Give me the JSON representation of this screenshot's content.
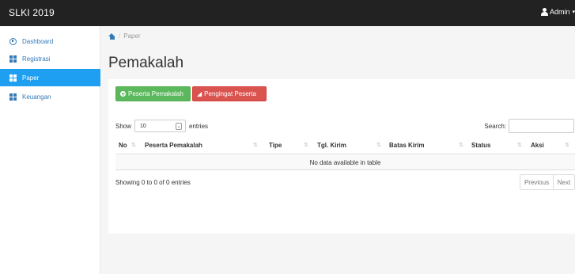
{
  "app": {
    "title": "SLKI 2019",
    "user_label": "Admin"
  },
  "sidebar": {
    "items": [
      {
        "label": "Dashboard",
        "icon": "dashboard-icon",
        "active": false
      },
      {
        "label": "Registrasi",
        "icon": "grid-icon",
        "active": false
      },
      {
        "label": "Paper",
        "icon": "grid-icon",
        "active": true
      },
      {
        "label": "Keuangan",
        "icon": "grid-icon",
        "active": false
      }
    ]
  },
  "breadcrumb": {
    "current": "Paper",
    "separator": "/"
  },
  "page": {
    "title": "Pemakalah"
  },
  "actions": {
    "peserta_pemakalah": "Peserta Pemakalah",
    "pengingat_peserta": "Pengingat Peserta"
  },
  "table": {
    "show_label": "Show",
    "entries_value": "10",
    "entries_label": "entries",
    "search_label": "Search:",
    "columns": [
      "No",
      "Peserta Pemakalah",
      "Tipe",
      "Tgl. Kirim",
      "Batas Kirim",
      "Status",
      "Aksi"
    ],
    "empty_message": "No data available in table",
    "info": "Showing 0 to 0 of 0 entries",
    "pagination": {
      "previous": "Previous",
      "next": "Next"
    }
  },
  "colors": {
    "topbar": "#222222",
    "sidebar_active": "#1e9ff2",
    "link": "#337ab7",
    "success": "#5cb85c",
    "danger": "#d9534f"
  }
}
